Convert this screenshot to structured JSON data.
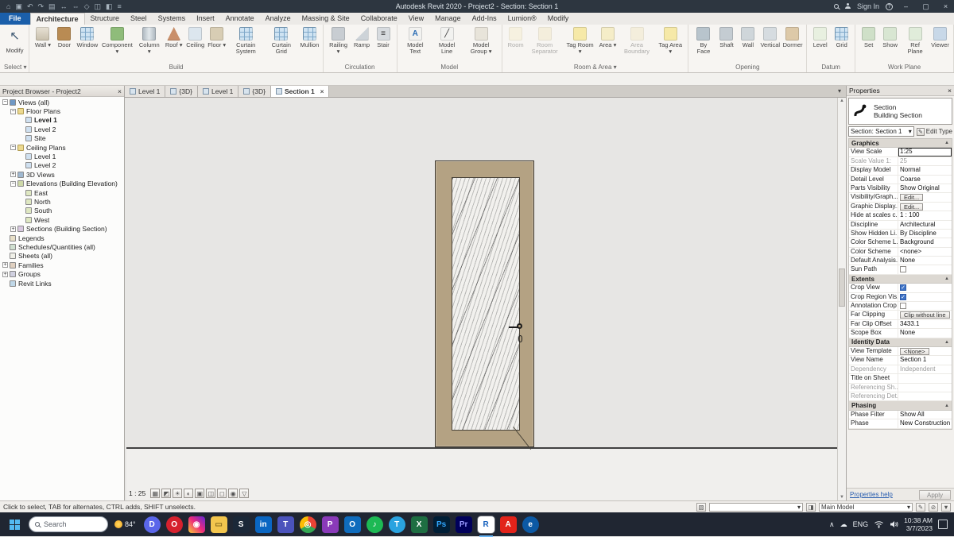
{
  "titlebar": {
    "title": "Autodesk Revit 2020 - Project2 - Section: Section 1",
    "signin": "Sign In",
    "quick_icons": [
      "home",
      "save",
      "undo",
      "redo",
      "print",
      "measure",
      "dimension",
      "tag",
      "view-cube",
      "section",
      "thin-lines"
    ],
    "window": {
      "min": "–",
      "max": "▢",
      "close": "×"
    }
  },
  "menu": {
    "tabs": [
      {
        "label": "File",
        "type": "file"
      },
      {
        "label": "Architecture",
        "active": true
      },
      {
        "label": "Structure"
      },
      {
        "label": "Steel"
      },
      {
        "label": "Systems"
      },
      {
        "label": "Insert"
      },
      {
        "label": "Annotate"
      },
      {
        "label": "Analyze"
      },
      {
        "label": "Massing & Site"
      },
      {
        "label": "Collaborate"
      },
      {
        "label": "View"
      },
      {
        "label": "Manage"
      },
      {
        "label": "Add-Ins"
      },
      {
        "label": "Lumion®"
      },
      {
        "label": "Modify"
      }
    ]
  },
  "ribbon": {
    "groups": [
      {
        "name": "Select ▾",
        "tools": [
          {
            "label": "Modify",
            "icon": "modify-cursor",
            "big": true
          }
        ]
      },
      {
        "name": "Build",
        "tools": [
          {
            "label": "Wall",
            "icon": "wall",
            "arrow": true
          },
          {
            "label": "Door",
            "icon": "door"
          },
          {
            "label": "Window",
            "icon": "window"
          },
          {
            "label": "Component",
            "icon": "component",
            "arrow": true
          },
          {
            "label": "Column",
            "icon": "column",
            "arrow": true
          },
          {
            "label": "Roof",
            "icon": "roof",
            "arrow": true
          },
          {
            "label": "Ceiling",
            "icon": "ceiling"
          },
          {
            "label": "Floor",
            "icon": "floor",
            "arrow": true
          },
          {
            "label": "Curtain System",
            "icon": "curtain-system"
          },
          {
            "label": "Curtain Grid",
            "icon": "curtain-grid"
          },
          {
            "label": "Mullion",
            "icon": "mullion"
          }
        ]
      },
      {
        "name": "Circulation",
        "tools": [
          {
            "label": "Railing",
            "icon": "railing",
            "arrow": true
          },
          {
            "label": "Ramp",
            "icon": "ramp"
          },
          {
            "label": "Stair",
            "icon": "stair"
          }
        ]
      },
      {
        "name": "Model",
        "tools": [
          {
            "label": "Model Text",
            "icon": "model-text"
          },
          {
            "label": "Model Line",
            "icon": "model-line"
          },
          {
            "label": "Model Group",
            "icon": "model-group",
            "arrow": true
          }
        ]
      },
      {
        "name": "Room & Area ▾",
        "tools": [
          {
            "label": "Room",
            "icon": "room",
            "disabled": true
          },
          {
            "label": "Room Separator",
            "icon": "room-separator",
            "disabled": true
          },
          {
            "label": "Tag Room",
            "icon": "tag-room",
            "arrow": true
          },
          {
            "label": "Area",
            "icon": "area",
            "arrow": true
          },
          {
            "label": "Area Boundary",
            "icon": "area-boundary",
            "disabled": true
          },
          {
            "label": "Tag Area",
            "icon": "tag-area",
            "arrow": true
          }
        ]
      },
      {
        "name": "Opening",
        "tools": [
          {
            "label": "By Face",
            "icon": "by-face"
          },
          {
            "label": "Shaft",
            "icon": "shaft"
          },
          {
            "label": "Wall",
            "icon": "wall-opening"
          },
          {
            "label": "Vertical",
            "icon": "vertical-opening"
          },
          {
            "label": "Dormer",
            "icon": "dormer"
          }
        ]
      },
      {
        "name": "Datum",
        "tools": [
          {
            "label": "Level",
            "icon": "level"
          },
          {
            "label": "Grid",
            "icon": "grid"
          }
        ]
      },
      {
        "name": "Work Plane",
        "tools": [
          {
            "label": "Set",
            "icon": "set-plane"
          },
          {
            "label": "Show",
            "icon": "show-plane"
          },
          {
            "label": "Ref Plane",
            "icon": "ref-plane"
          },
          {
            "label": "Viewer",
            "icon": "viewer"
          }
        ]
      }
    ]
  },
  "project_browser": {
    "title": "Project Browser - Project2",
    "items": [
      {
        "label": "Views (all)",
        "level": 0,
        "exp": "minus",
        "icon": "views"
      },
      {
        "label": "Floor Plans",
        "level": 1,
        "exp": "minus",
        "icon": "folder"
      },
      {
        "label": "Level 1",
        "level": 2,
        "icon": "plan",
        "bold": true
      },
      {
        "label": "Level 2",
        "level": 2,
        "icon": "plan"
      },
      {
        "label": "Site",
        "level": 2,
        "icon": "plan"
      },
      {
        "label": "Ceiling Plans",
        "level": 1,
        "exp": "minus",
        "icon": "folder"
      },
      {
        "label": "Level 1",
        "level": 2,
        "icon": "plan"
      },
      {
        "label": "Level 2",
        "level": 2,
        "icon": "plan"
      },
      {
        "label": "3D Views",
        "level": 1,
        "exp": "plus",
        "icon": "threed"
      },
      {
        "label": "Elevations (Building Elevation)",
        "level": 1,
        "exp": "minus",
        "icon": "elev"
      },
      {
        "label": "East",
        "level": 2,
        "icon": "elevview"
      },
      {
        "label": "North",
        "level": 2,
        "icon": "elevview"
      },
      {
        "label": "South",
        "level": 2,
        "icon": "elevview"
      },
      {
        "label": "West",
        "level": 2,
        "icon": "elevview"
      },
      {
        "label": "Sections (Building Section)",
        "level": 1,
        "exp": "plus",
        "icon": "sec"
      },
      {
        "label": "Legends",
        "level": 0,
        "icon": "legend"
      },
      {
        "label": "Schedules/Quantities (all)",
        "level": 0,
        "icon": "sched"
      },
      {
        "label": "Sheets (all)",
        "level": 0,
        "icon": "sheet"
      },
      {
        "label": "Families",
        "level": 0,
        "exp": "plus",
        "icon": "family"
      },
      {
        "label": "Groups",
        "level": 0,
        "exp": "plus",
        "icon": "group"
      },
      {
        "label": "Revit Links",
        "level": 0,
        "icon": "link"
      }
    ]
  },
  "view_tabs": [
    {
      "label": "Level 1",
      "icon": "plan"
    },
    {
      "label": "{3D}",
      "icon": "threed"
    },
    {
      "label": "Level 1",
      "icon": "plan"
    },
    {
      "label": "{3D}",
      "icon": "threed"
    },
    {
      "label": "Section 1",
      "icon": "sec",
      "active": true,
      "closable": true
    }
  ],
  "canvas": {
    "scale_label": "1 : 25",
    "view_icons": [
      "detail-level",
      "visual-style",
      "sun-path",
      "shadows",
      "crop-view",
      "show-crop",
      "temporary-hide",
      "reveal-hidden",
      "analysis"
    ]
  },
  "properties": {
    "panel_title": "Properties",
    "type_name": "Section",
    "type_family": "Building Section",
    "selector": "Section: Section 1",
    "edit_type": "Edit Type",
    "sections": [
      {
        "header": "Graphics",
        "rows": [
          {
            "label": "View Scale",
            "value": "1:25",
            "focus": true
          },
          {
            "label": "Scale Value  1:",
            "value": "25",
            "muted": true
          },
          {
            "label": "Display Model",
            "value": "Normal"
          },
          {
            "label": "Detail Level",
            "value": "Coarse"
          },
          {
            "label": "Parts Visibility",
            "value": "Show Original"
          },
          {
            "label": "Visibility/Graph...",
            "value": "Edit...",
            "button": true
          },
          {
            "label": "Graphic Display...",
            "value": "Edit...",
            "button": true
          },
          {
            "label": "Hide at scales c...",
            "value": "1 : 100"
          },
          {
            "label": "Discipline",
            "value": "Architectural"
          },
          {
            "label": "Show Hidden Li...",
            "value": "By Discipline"
          },
          {
            "label": "Color Scheme L...",
            "value": "Background"
          },
          {
            "label": "Color Scheme",
            "value": "<none>"
          },
          {
            "label": "Default Analysis...",
            "value": "None"
          },
          {
            "label": "Sun Path",
            "check": false
          }
        ]
      },
      {
        "header": "Extents",
        "rows": [
          {
            "label": "Crop View",
            "check": true
          },
          {
            "label": "Crop Region Vis...",
            "check": true
          },
          {
            "label": "Annotation Crop",
            "check": false
          },
          {
            "label": "Far Clipping",
            "value": "Clip without line",
            "button": true
          },
          {
            "label": "Far Clip Offset",
            "value": "3433.1"
          },
          {
            "label": "Scope Box",
            "value": "None"
          }
        ]
      },
      {
        "header": "Identity Data",
        "rows": [
          {
            "label": "View Template",
            "value": "<None>",
            "button": true
          },
          {
            "label": "View Name",
            "value": "Section 1"
          },
          {
            "label": "Dependency",
            "value": "Independent",
            "muted": true
          },
          {
            "label": "Title on Sheet",
            "value": ""
          },
          {
            "label": "Referencing Sh...",
            "value": "",
            "muted": true
          },
          {
            "label": "Referencing Det...",
            "value": "",
            "muted": true
          }
        ]
      },
      {
        "header": "Phasing",
        "rows": [
          {
            "label": "Phase Filter",
            "value": "Show All"
          },
          {
            "label": "Phase",
            "value": "New Construction"
          }
        ]
      }
    ],
    "help": "Properties help",
    "apply": "Apply"
  },
  "status_bar": {
    "message": "Click to select, TAB for alternates, CTRL adds, SHIFT unselects.",
    "combo1": "",
    "combo2": "Main Model",
    "left_icon": "worksets",
    "mid_icon": "design-options",
    "right_icons": [
      "editable-only",
      "exclude-options",
      "filter"
    ]
  },
  "taskbar": {
    "search_placeholder": "Search",
    "weather": "84°",
    "icons": [
      {
        "name": "discord",
        "glyph": "D",
        "bg": "#5a66ea",
        "round": true
      },
      {
        "name": "opera",
        "glyph": "O",
        "bg": "#d6212e",
        "round": true
      },
      {
        "name": "instagram",
        "glyph": "◉",
        "bg": "linear-gradient(45deg,#f9ce34,#ee2a7b,#6228d7)"
      },
      {
        "name": "file-explorer",
        "glyph": "▭",
        "bg": "#f3c64e",
        "fg": "#8a6d1f"
      },
      {
        "name": "steam",
        "glyph": "S",
        "bg": "#1b2838"
      },
      {
        "name": "linkedin",
        "glyph": "in",
        "bg": "#0a66c2"
      },
      {
        "name": "teams",
        "glyph": "T",
        "bg": "#4b53bc"
      },
      {
        "name": "chrome",
        "glyph": "◎",
        "bg": "conic-gradient(#ea4335 0 120deg,#34a853 120deg 240deg,#fbbc05 240deg 360deg)",
        "round": true
      },
      {
        "name": "app-purple",
        "glyph": "P",
        "bg": "#8a3ab9"
      },
      {
        "name": "outlook",
        "glyph": "O",
        "bg": "#0f6cbd"
      },
      {
        "name": "spotify",
        "glyph": "♪",
        "bg": "#1db954",
        "round": true
      },
      {
        "name": "telegram",
        "glyph": "T",
        "bg": "#2aa3e0",
        "round": true
      },
      {
        "name": "excel",
        "glyph": "X",
        "bg": "#1e6e42"
      },
      {
        "name": "photoshop",
        "glyph": "Ps",
        "bg": "#001e36",
        "fg": "#31a8ff"
      },
      {
        "name": "premiere",
        "glyph": "Pr",
        "bg": "#00005b",
        "fg": "#9999ff"
      },
      {
        "name": "revit",
        "glyph": "R",
        "bg": "#ffffff",
        "fg": "#1560bd",
        "active": true
      },
      {
        "name": "acrobat",
        "glyph": "A",
        "bg": "#e2231a"
      },
      {
        "name": "edge",
        "glyph": "e",
        "bg": "#0c59a4",
        "round": true
      }
    ],
    "tray": {
      "chevron": "∧",
      "lang": "ENG",
      "time": "10:38 AM",
      "date": "3/7/2023"
    }
  }
}
